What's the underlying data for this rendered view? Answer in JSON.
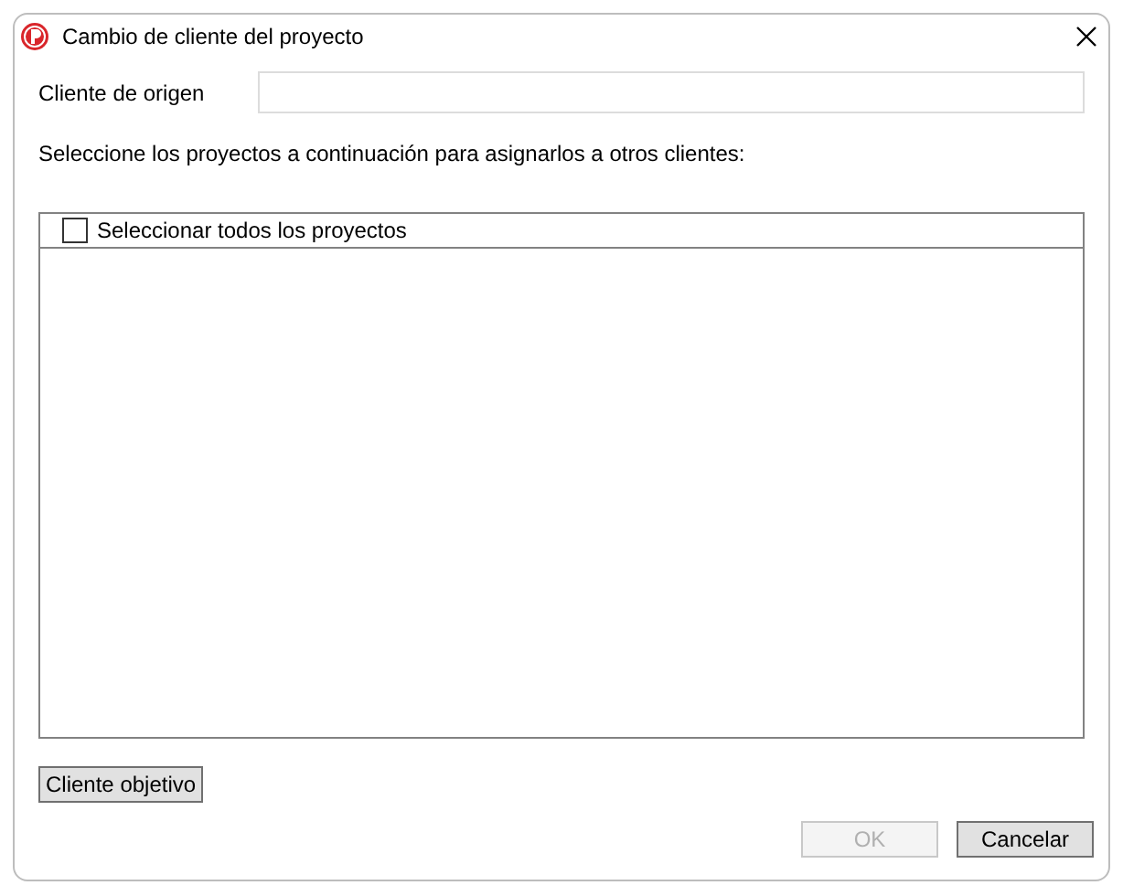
{
  "window": {
    "title": "Cambio de cliente del proyecto"
  },
  "source_client": {
    "label": "Cliente de origen"
  },
  "instruction": "Seleccione los proyectos a continuación para asignarlos a otros clientes:",
  "project_list": {
    "select_all": {
      "label": "Seleccionar todos los proyectos",
      "checked": false
    }
  },
  "target_button": "Cliente objetivo",
  "buttons": [
    {
      "label": "OK",
      "disabled": true
    },
    {
      "label": "Cancelar",
      "disabled": false
    }
  ]
}
